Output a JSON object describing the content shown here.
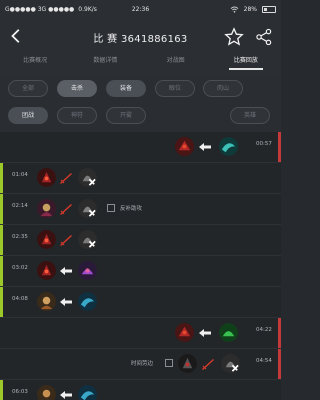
{
  "status_bar": {
    "left": "G●●●●● 3G ●●●●●",
    "speed": "0.9K/s",
    "time": "22:36",
    "battery": "28%"
  },
  "header": {
    "title": "比 赛 3641886163"
  },
  "tabs": [
    {
      "label": "比赛概况"
    },
    {
      "label": "数据详情"
    },
    {
      "label": "对战图"
    },
    {
      "label": "比赛回放"
    }
  ],
  "filters": {
    "row1": [
      {
        "label": "全部"
      },
      {
        "label": "击杀"
      },
      {
        "label": "装备"
      },
      {
        "label": "眼位"
      },
      {
        "label": "肉山"
      }
    ],
    "row2": [
      {
        "label": "团战"
      },
      {
        "label": "神符"
      },
      {
        "label": "开雾"
      },
      {
        "label": "英雄"
      }
    ]
  },
  "timeline": [
    {
      "side": "right",
      "time": "00:57"
    },
    {
      "side": "left",
      "time": "01:04"
    },
    {
      "side": "left",
      "time": "02:14",
      "note": "反补助攻"
    },
    {
      "side": "left",
      "time": "02:35"
    },
    {
      "side": "left",
      "time": "03:02"
    },
    {
      "side": "left",
      "time": "04:08"
    },
    {
      "side": "right",
      "time": "04:22"
    },
    {
      "side": "right",
      "time": "04:54",
      "note": "时间劳边"
    },
    {
      "side": "left",
      "time": "06:03"
    }
  ],
  "colors": {
    "radiant": "#9cc82c",
    "dire": "#c43a3a",
    "background": "#232629"
  }
}
